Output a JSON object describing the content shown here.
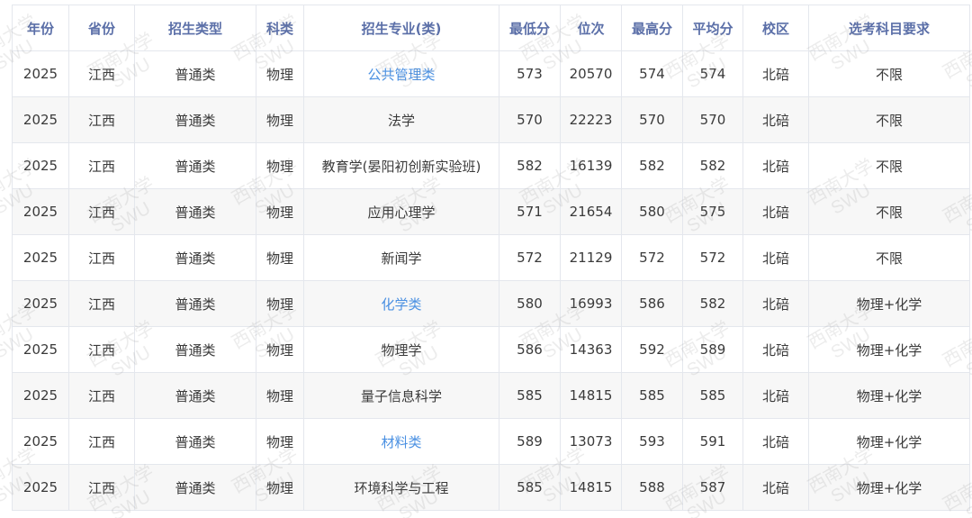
{
  "table": {
    "headers": [
      "年份",
      "省份",
      "招生类型",
      "科类",
      "招生专业(类)",
      "最低分",
      "位次",
      "最高分",
      "平均分",
      "校区",
      "选考科目要求"
    ],
    "rows": [
      {
        "year": "2025",
        "province": "江西",
        "type": "普通类",
        "category": "物理",
        "major": "公共管理类",
        "major_link": true,
        "min": "573",
        "rank": "20570",
        "max": "574",
        "avg": "574",
        "campus": "北碚",
        "req": "不限"
      },
      {
        "year": "2025",
        "province": "江西",
        "type": "普通类",
        "category": "物理",
        "major": "法学",
        "major_link": false,
        "min": "570",
        "rank": "22223",
        "max": "570",
        "avg": "570",
        "campus": "北碚",
        "req": "不限"
      },
      {
        "year": "2025",
        "province": "江西",
        "type": "普通类",
        "category": "物理",
        "major": "教育学(晏阳初创新实验班)",
        "major_link": false,
        "min": "582",
        "rank": "16139",
        "max": "582",
        "avg": "582",
        "campus": "北碚",
        "req": "不限"
      },
      {
        "year": "2025",
        "province": "江西",
        "type": "普通类",
        "category": "物理",
        "major": "应用心理学",
        "major_link": false,
        "min": "571",
        "rank": "21654",
        "max": "580",
        "avg": "575",
        "campus": "北碚",
        "req": "不限"
      },
      {
        "year": "2025",
        "province": "江西",
        "type": "普通类",
        "category": "物理",
        "major": "新闻学",
        "major_link": false,
        "min": "572",
        "rank": "21129",
        "max": "572",
        "avg": "572",
        "campus": "北碚",
        "req": "不限"
      },
      {
        "year": "2025",
        "province": "江西",
        "type": "普通类",
        "category": "物理",
        "major": "化学类",
        "major_link": true,
        "min": "580",
        "rank": "16993",
        "max": "586",
        "avg": "582",
        "campus": "北碚",
        "req": "物理+化学"
      },
      {
        "year": "2025",
        "province": "江西",
        "type": "普通类",
        "category": "物理",
        "major": "物理学",
        "major_link": false,
        "min": "586",
        "rank": "14363",
        "max": "592",
        "avg": "589",
        "campus": "北碚",
        "req": "物理+化学"
      },
      {
        "year": "2025",
        "province": "江西",
        "type": "普通类",
        "category": "物理",
        "major": "量子信息科学",
        "major_link": false,
        "min": "585",
        "rank": "14815",
        "max": "585",
        "avg": "585",
        "campus": "北碚",
        "req": "物理+化学"
      },
      {
        "year": "2025",
        "province": "江西",
        "type": "普通类",
        "category": "物理",
        "major": "材料类",
        "major_link": true,
        "min": "589",
        "rank": "13073",
        "max": "593",
        "avg": "591",
        "campus": "北碚",
        "req": "物理+化学"
      },
      {
        "year": "2025",
        "province": "江西",
        "type": "普通类",
        "category": "物理",
        "major": "环境科学与工程",
        "major_link": false,
        "min": "585",
        "rank": "14815",
        "max": "588",
        "avg": "587",
        "campus": "北碚",
        "req": "物理+化学"
      }
    ]
  },
  "watermark": {
    "line1": "西南大学",
    "line2": "SWU"
  },
  "colors": {
    "header_text": "#5b6fa8",
    "link": "#4a90e2",
    "stripe": "#f7f7f7",
    "border": "#e4e7ed"
  }
}
